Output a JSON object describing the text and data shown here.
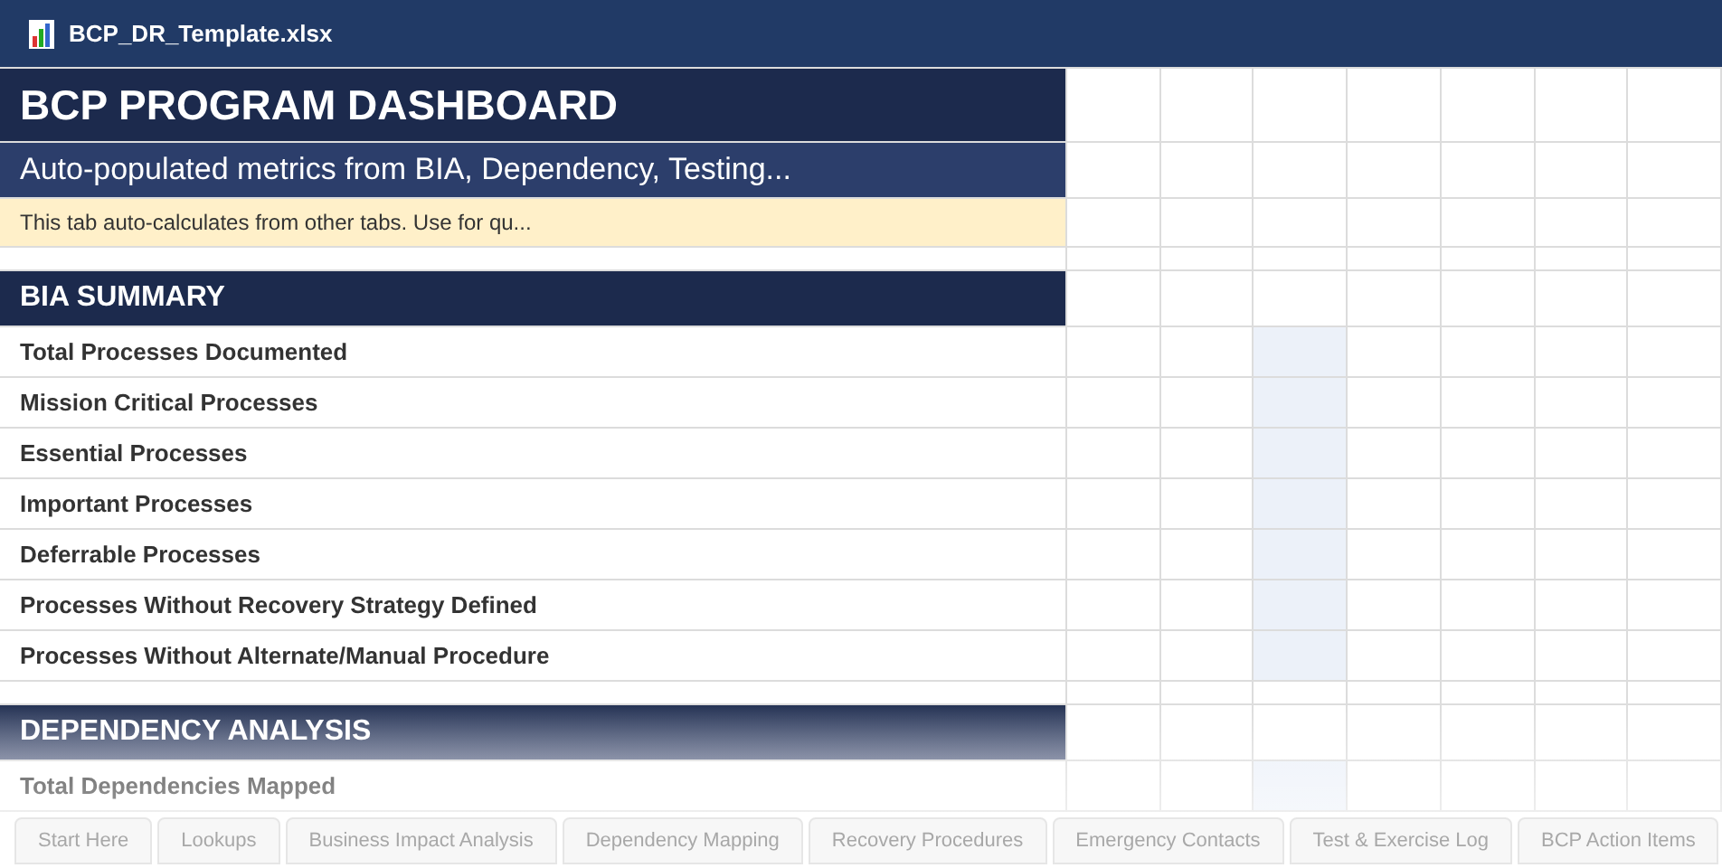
{
  "window": {
    "title": "BCP_DR_Template.xlsx"
  },
  "rows": [
    {
      "kind": "title",
      "text": "BCP PROGRAM DASHBOARD"
    },
    {
      "kind": "subtitle",
      "text": "Auto-populated metrics from BIA, Dependency, Testing..."
    },
    {
      "kind": "note",
      "text": "This tab auto-calculates from other tabs. Use for qu..."
    },
    {
      "kind": "spacer"
    },
    {
      "kind": "section",
      "text": "BIA SUMMARY"
    },
    {
      "kind": "metric",
      "text": "Total Processes Documented",
      "input_highlighted": true
    },
    {
      "kind": "metric",
      "text": "Mission Critical Processes",
      "input_highlighted": true
    },
    {
      "kind": "metric",
      "text": "Essential Processes",
      "input_highlighted": true
    },
    {
      "kind": "metric",
      "text": "Important Processes",
      "input_highlighted": true
    },
    {
      "kind": "metric",
      "text": "Deferrable Processes",
      "input_highlighted": true
    },
    {
      "kind": "metric",
      "text": "Processes Without Recovery Strategy Defined",
      "input_highlighted": true
    },
    {
      "kind": "metric",
      "text": "Processes Without Alternate/Manual Procedure",
      "input_highlighted": true
    },
    {
      "kind": "spacer"
    },
    {
      "kind": "section",
      "text": "DEPENDENCY ANALYSIS"
    },
    {
      "kind": "metric",
      "text": "Total Dependencies Mapped",
      "input_highlighted": true
    }
  ],
  "sheet_tabs": [
    {
      "label": "Start Here",
      "selected": false
    },
    {
      "label": "Lookups",
      "selected": false
    },
    {
      "label": "Business Impact Analysis",
      "selected": false
    },
    {
      "label": "Dependency Mapping",
      "selected": false
    },
    {
      "label": "Recovery Procedures",
      "selected": false
    },
    {
      "label": "Emergency Contacts",
      "selected": false
    },
    {
      "label": "Test & Exercise Log",
      "selected": false
    },
    {
      "label": "BCP Action Items",
      "selected": false
    }
  ]
}
